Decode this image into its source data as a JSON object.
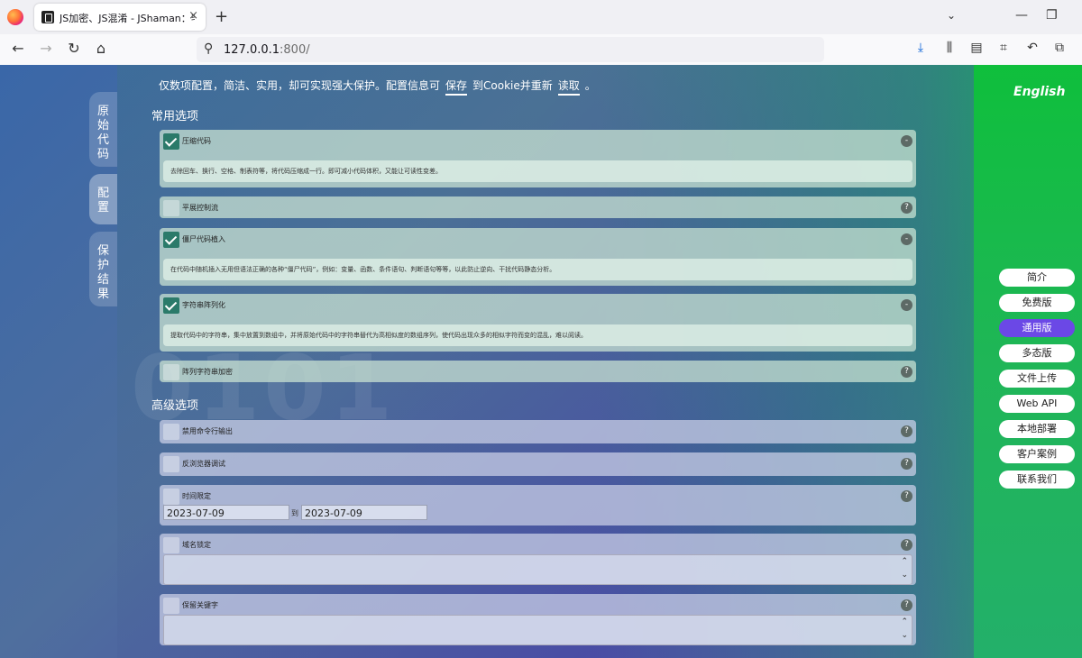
{
  "browser": {
    "tab_title": "JS加密、JS混淆 - JShaman：毛",
    "tab_close": "×",
    "new_tab": "+",
    "url_host": "127.0.0.1",
    "url_rest": ":800/",
    "minimize": "—",
    "restore": "❐",
    "tab_list": "⌄"
  },
  "page": {
    "intro_text": "仅数项配置，简洁、实用，却可实现强大保护。配置信息可",
    "save_link": "保存",
    "intro_mid": "到Cookie并重新",
    "load_link": "读取",
    "intro_end": "。",
    "vtabs": [
      "原始代码",
      "配置",
      "保护结果"
    ],
    "common_title": "常用选项",
    "advanced_title": "高级选项",
    "english": "English",
    "watermark": "0101",
    "options": {
      "compress": {
        "label": "压缩代码",
        "checked": true,
        "help": "-",
        "desc": "去除回车、换行、空格、制表符等，将代码压缩成一行。即可减小代码体积，又能让可读性变差。"
      },
      "flatten": {
        "label": "平展控制流",
        "checked": false,
        "help": "?"
      },
      "zombie": {
        "label": "僵尸代码植入",
        "checked": true,
        "help": "-",
        "desc": "在代码中随机插入无用但语法正确的各种“僵尸代码”，例如：变量、函数、条件语句、判断语句等等，以此防止逆向、干扰代码静态分析。"
      },
      "string_array": {
        "label": "字符串阵列化",
        "checked": true,
        "help": "-",
        "desc": "提取代码中的字符串，集中放置到数组中，并将原始代码中的字符串替代为高相似度的数组序列，使代码出现众多的相似字符而变的混乱，难以阅读。"
      },
      "array_encrypt": {
        "label": "阵列字符串加密",
        "checked": false,
        "help": "?"
      },
      "disable_console": {
        "label": "禁用命令行输出",
        "checked": false,
        "help": "?"
      },
      "anti_debug": {
        "label": "反浏览器调试",
        "checked": false,
        "help": "?"
      },
      "time_limit": {
        "label": "时间限定",
        "checked": false,
        "help": "?",
        "from": "2023-07-09",
        "to_label": "到",
        "to": "2023-07-09"
      },
      "domain_lock": {
        "label": "域名锁定",
        "checked": false,
        "help": "?"
      },
      "reserved_words": {
        "label": "保留关键字",
        "checked": false,
        "help": "?"
      }
    },
    "side_nav": [
      {
        "label": "简介",
        "active": false
      },
      {
        "label": "免费版",
        "active": false
      },
      {
        "label": "通用版",
        "active": true
      },
      {
        "label": "多态版",
        "active": false
      },
      {
        "label": "文件上传",
        "active": false
      },
      {
        "label": "Web API",
        "active": false
      },
      {
        "label": "本地部署",
        "active": false
      },
      {
        "label": "客户案例",
        "active": false
      },
      {
        "label": "联系我们",
        "active": false
      }
    ]
  }
}
